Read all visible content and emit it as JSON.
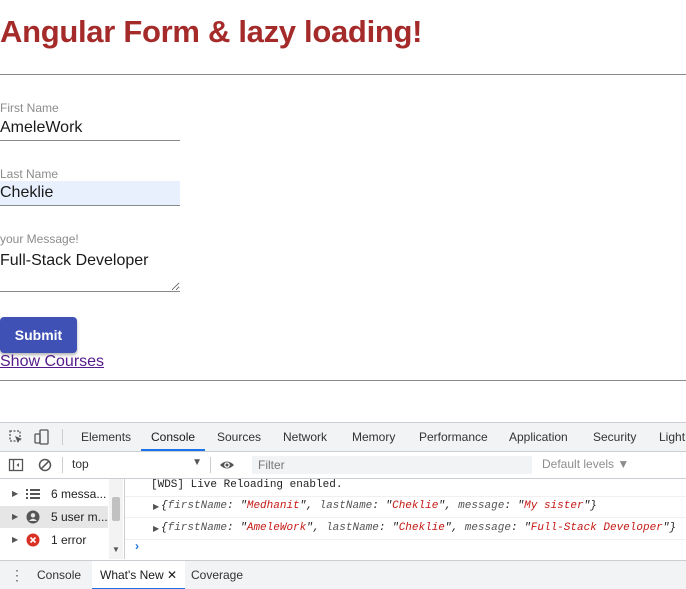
{
  "page": {
    "title": "Angular Form & lazy loading!",
    "form": {
      "first_name": {
        "label": "First Name",
        "value": "AmeleWork"
      },
      "last_name": {
        "label": "Last Name",
        "value": "Cheklie"
      },
      "message": {
        "label": "your Message!",
        "value": "Full-Stack Developer"
      },
      "submit_label": "Submit"
    },
    "show_courses_link": "Show Courses"
  },
  "devtools": {
    "tabs": [
      {
        "label": "Elements",
        "active": false
      },
      {
        "label": "Console",
        "active": true
      },
      {
        "label": "Sources",
        "active": false
      },
      {
        "label": "Network",
        "active": false
      },
      {
        "label": "Memory",
        "active": false
      },
      {
        "label": "Performance",
        "active": false
      },
      {
        "label": "Application",
        "active": false
      },
      {
        "label": "Security",
        "active": false
      },
      {
        "label": "Light",
        "active": false
      }
    ],
    "toolbar": {
      "context": "top",
      "filter_placeholder": "Filter",
      "levels": "Default levels ▼"
    },
    "sidebar": [
      {
        "label": "6 messa...",
        "icon": "list-icon"
      },
      {
        "label": "5 user m...",
        "icon": "user-icon",
        "selected": true
      },
      {
        "label": "1 error",
        "icon": "error-icon"
      }
    ],
    "console": {
      "first_line": "[WDS] Live Reloading enabled.",
      "logs": [
        {
          "firstName": "Medhanit",
          "lastName": "Cheklie",
          "message": "My sister"
        },
        {
          "firstName": "AmeleWork",
          "lastName": "Cheklie",
          "message": "Full-Stack Developer"
        }
      ],
      "keys": {
        "firstName": "firstName",
        "lastName": "lastName",
        "message": "message"
      }
    },
    "drawer": {
      "tabs": [
        {
          "label": "Console",
          "active": false
        },
        {
          "label": "What's New",
          "active": true
        },
        {
          "label": "Coverage",
          "active": false
        }
      ],
      "menu_icon": "⋮",
      "close_icon": "✕"
    },
    "colors": {
      "accent": "#1a73e8",
      "title": "#a52a2a",
      "button": "#3f51b5",
      "string": "#c41a16",
      "error": "#d93025"
    }
  }
}
